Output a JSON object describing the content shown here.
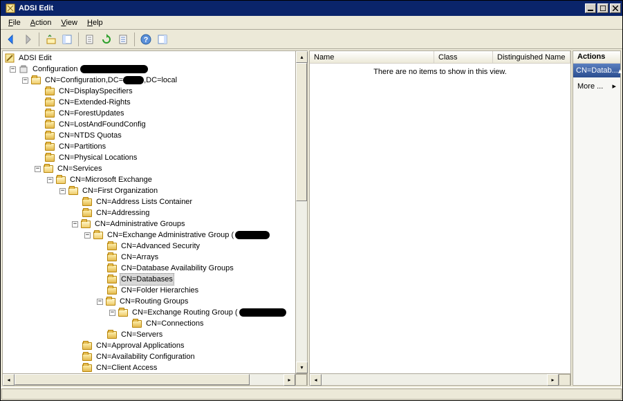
{
  "window": {
    "title": "ADSI Edit"
  },
  "menu": {
    "file": "File",
    "action": "Action",
    "view": "View",
    "help": "Help"
  },
  "toolbar_icons": [
    "back",
    "forward",
    "up",
    "show-hide",
    "export",
    "delete",
    "refresh",
    "properties",
    "help",
    "show-hide-action"
  ],
  "tree": {
    "root": "ADSI Edit",
    "config_context": "Configuration",
    "config_dn_pre": "CN=Configuration,DC=",
    "config_dn_suf": ",DC=local",
    "items": {
      "display_specifiers": "CN=DisplaySpecifiers",
      "extended_rights": "CN=Extended-Rights",
      "forest_updates": "CN=ForestUpdates",
      "lost_and_found": "CN=LostAndFoundConfig",
      "ntds_quotas": "CN=NTDS Quotas",
      "partitions": "CN=Partitions",
      "physical_locations": "CN=Physical Locations",
      "services": "CN=Services",
      "ms_exchange": "CN=Microsoft Exchange",
      "first_org": "CN=First Organization",
      "addr_lists": "CN=Address Lists Container",
      "addressing": "CN=Addressing",
      "admin_groups": "CN=Administrative Groups",
      "exch_admin_group": "CN=Exchange Administrative Group (",
      "adv_security": "CN=Advanced Security",
      "arrays": "CN=Arrays",
      "dag": "CN=Database Availability Groups",
      "databases": "CN=Databases",
      "folder_hier": "CN=Folder Hierarchies",
      "routing_groups": "CN=Routing Groups",
      "exch_routing_group": "CN=Exchange Routing Group (",
      "connections": "CN=Connections",
      "servers": "CN=Servers",
      "approval_apps": "CN=Approval Applications",
      "avail_config": "CN=Availability Configuration",
      "client_access": "CN=Client Access"
    }
  },
  "list": {
    "columns": {
      "name": "Name",
      "class": "Class",
      "dn": "Distinguished Name"
    },
    "empty": "There are no items to show in this view."
  },
  "actions": {
    "header": "Actions",
    "selected": "CN=Datab...",
    "more": "More ..."
  }
}
